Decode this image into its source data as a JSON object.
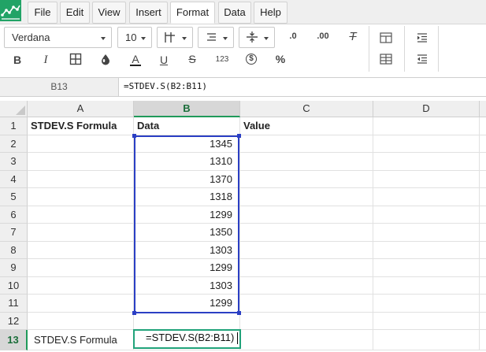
{
  "menubar": {
    "items": [
      "File",
      "Edit",
      "View",
      "Insert",
      "Format",
      "Data",
      "Help"
    ],
    "active": "Format"
  },
  "toolbar": {
    "font_family": "Verdana",
    "font_size": "10",
    "number_format_label": "123",
    "currency_label": "$",
    "percent_label": "%",
    "bold_label": "B",
    "italic_label": "I",
    "underline_label": "U",
    "strike_label": "S",
    "text_color_label": "A",
    "decrease_decimals_label": ".0",
    "increase_decimals_label": ".00",
    "clear_format_label": "T"
  },
  "formula_bar": {
    "cell_ref": "B13",
    "formula": "=STDEV.S(B2:B11)"
  },
  "sheet": {
    "columns": [
      "A",
      "B",
      "C",
      "D"
    ],
    "rows": [
      "1",
      "2",
      "3",
      "4",
      "5",
      "6",
      "7",
      "8",
      "9",
      "10",
      "11",
      "12",
      "13"
    ],
    "cells": {
      "A1": "STDEV.S Formula",
      "B1": "Data",
      "C1": "Value",
      "B2": "1345",
      "B3": "1310",
      "B4": "1370",
      "B5": "1318",
      "B6": "1299",
      "B7": "1350",
      "B8": "1303",
      "B9": "1299",
      "B10": "1303",
      "B11": "1299",
      "A13": "STDEV.S Formula",
      "B13": "=STDEV.S(B2:B11)"
    },
    "active_cell": "B13",
    "selected_range": "B2:B11"
  },
  "colors": {
    "brand_green": "#21a366",
    "range_border": "#2b3fc4",
    "active_border": "#21a37a"
  }
}
